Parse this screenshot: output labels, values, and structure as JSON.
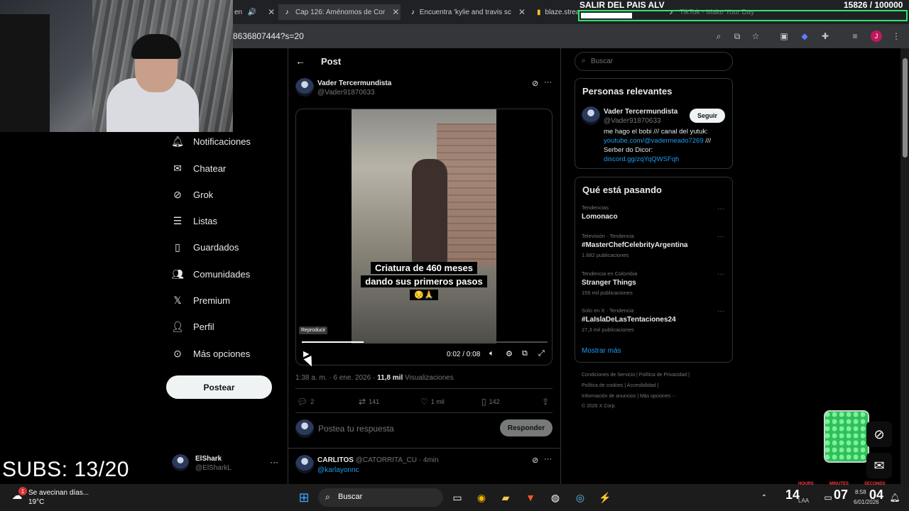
{
  "browser": {
    "tabs": [
      {
        "title": "en",
        "icon": "speaker-icon"
      },
      {
        "title": "Cap 126: Aménomos de Cor",
        "icon": "tiktok-icon"
      },
      {
        "title": "Encuentra 'kylie and travis sc",
        "icon": "tiktok-icon"
      },
      {
        "title": "blaze.stream/",
        "icon": "blaze-icon"
      },
      {
        "title": "TikTok - Make Your Day",
        "icon": "tiktok-icon"
      }
    ],
    "url": "8636807444?s=20"
  },
  "stream": {
    "subs": "SUBS: 13/20",
    "goal_title": "SALIR DEL PAIS ALV",
    "goal_count": "15826",
    "goal_total": "/ 100000",
    "goal_progress": 0.158
  },
  "nav": {
    "items": [
      {
        "label": "Notificaciones",
        "icon": "bell-icon"
      },
      {
        "label": "Chatear",
        "icon": "mail-icon"
      },
      {
        "label": "Grok",
        "icon": "grok-icon"
      },
      {
        "label": "Listas",
        "icon": "list-icon"
      },
      {
        "label": "Guardados",
        "icon": "bookmark-icon"
      },
      {
        "label": "Comunidades",
        "icon": "people-icon"
      },
      {
        "label": "Premium",
        "icon": "x-logo-icon"
      },
      {
        "label": "Perfil",
        "icon": "person-icon"
      },
      {
        "label": "Más opciones",
        "icon": "more-circle-icon"
      }
    ],
    "post_button": "Postear",
    "account": {
      "name": "ElShark",
      "handle": "@ElSharkL"
    }
  },
  "post": {
    "header": "Post",
    "author": {
      "name": "Vader Tercermundista",
      "handle": "@Vader91870633"
    },
    "video": {
      "caption_line1": "Criatura de 460 meses",
      "caption_line2": "dando sus primeros pasos",
      "caption_emoji": "😔🙏",
      "tooltip": "Reproducir",
      "time": "0:02 / 0:08",
      "progress": 0.25
    },
    "meta_time": "1:38 a. m. · 6 ene. 2026 ·",
    "views": "11,8 mil",
    "views_label": "Visualizaciones",
    "replies": "2",
    "reposts": "141",
    "likes": "1 mil",
    "bookmarks": "142",
    "reply_placeholder": "Postea tu respuesta",
    "reply_button": "Responder",
    "comment": {
      "name": "CARLITOS",
      "handle": "@CATORRITA_CU",
      "time": "· 4min",
      "text": "@karlayonnc"
    }
  },
  "sidebar": {
    "search_placeholder": "Buscar",
    "relevant_title": "Personas relevantes",
    "relevant": {
      "name": "Vader Tercermundista",
      "handle": "@Vader91870633",
      "follow": "Seguir",
      "bio1": "me hago el bobi /// canal del yutuk:",
      "bio2_link": "youtube.com/@vadermeado7269",
      "bio2_rest": " ///",
      "bio3": "Serber do Dicor:",
      "bio4_link": "discord.gg/zqYqQWSFqh"
    },
    "trending_title": "Qué está pasando",
    "trends": [
      {
        "context": "Tendencias",
        "name": "Lomonaco",
        "count": ""
      },
      {
        "context": "Televisión · Tendencia",
        "name": "#MasterChefCelebrityArgentina",
        "count": "1.682 publicaciones"
      },
      {
        "context": "Tendencia en Colombia",
        "name": "Stranger Things",
        "count": "155 mil publicaciones"
      },
      {
        "context": "Solo en X · Tendencia",
        "name": "#LaIslaDeLasTentaciones24",
        "count": "27,3 mil publicaciones"
      }
    ],
    "show_more": "Mostrar más",
    "footer": [
      "Condiciones de Servicio  |  Política de Privacidad  |",
      "Política de cookies  |  Accesibilidad  |",
      "Información de anuncios  |  Más opciones ···",
      "© 2026 X Corp."
    ]
  },
  "taskbar": {
    "weather_text": "Se avecinan días...",
    "weather_temp": "19°C",
    "search": "Buscar",
    "clock_hours": "14",
    "clock_minutes": "07",
    "clock_seconds": "04",
    "clock_hours_label": "HOURS",
    "clock_minutes_label": "MINUTES",
    "clock_seconds_label": "SECONDS",
    "time": "8:58",
    "date": "6/01/2026",
    "lang": "LAA"
  }
}
